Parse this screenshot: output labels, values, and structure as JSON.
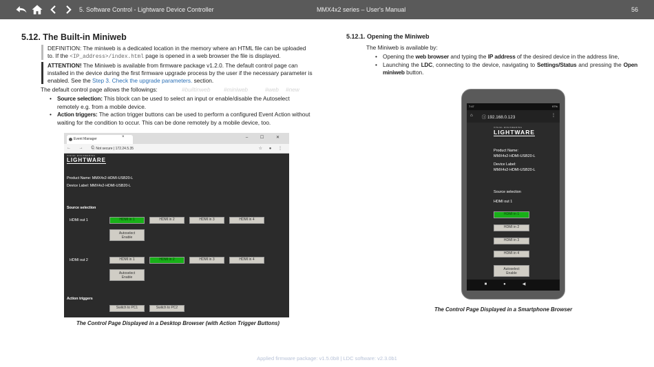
{
  "header": {
    "chapter": "5. Software Control - Lightware Device Controller",
    "manual": "MMX4x2 series – User's Manual",
    "page": "56",
    "icons": [
      "return-icon",
      "home-icon",
      "prev-icon",
      "next-icon"
    ]
  },
  "left": {
    "title": "5.12. The Built-in Miniweb",
    "definition": {
      "prefix": "DEFINITION: The miniweb is a dedicated location in the memory where an HTML file can be uploaded to. If the ",
      "code": "<IP_address>/index.html",
      "suffix": " page is opened in a web browser the file is displayed."
    },
    "attention": {
      "label": "ATTENTION!",
      "text1": " The Miniweb is available from firmware package v1.2.0. The default control page can installed in the device during the first firmware upgrade process by the user if the necessary parameter is enabled. See the ",
      "link": "Step 3. Check the upgrade parameters.",
      "text2": " section."
    },
    "default_page": "The default control page allows the followings:",
    "tags": [
      "#builtinweb",
      "#miniweb",
      "#web",
      "#new"
    ],
    "bullets": [
      {
        "label": "Source selection:",
        "text": " This block can be used to select an input or enable/disable the Autoselect remotely e.g. from a mobile device."
      },
      {
        "label": "Action triggers:",
        "text": " The action trigger buttons can be used to perform a configured Event Action without waiting for the condition to occur. This can be done remotely by a mobile device, too."
      }
    ],
    "desktop": {
      "tab": "Event Manager",
      "url_label": "Not secure",
      "url": "172.24.5.35",
      "logo": "LIGHTWARE",
      "logo_sub": "VISUAL ENGINEERING",
      "product_name": "Product Name: MMX4x2-HDMI-USB20-L",
      "device_label": "Device Label: MMX4x2-HDMI-USB20-L",
      "source_selection": "Source selection",
      "out1": "HDMI out 1",
      "out2": "HDMI out 2",
      "inputs": [
        "HDMI in 1",
        "HDMI in 2",
        "HDMI in 3",
        "HDMI in 4"
      ],
      "autoselect1": "Autoselect",
      "autoselect2": "Enable",
      "action_triggers": "Action triggers",
      "triggers": [
        "Switch to PC1",
        "Switch to PC2"
      ]
    },
    "caption": "The Control Page Displayed in a Desktop Browser (with Action Trigger Buttons)"
  },
  "right": {
    "title": "5.12.1. Opening the Miniweb",
    "intro": "The Miniweb is available by:",
    "bullets": [
      {
        "t1": "Opening the ",
        "b1": "web browser",
        "t2": " and typing the ",
        "b2": "IP address",
        "t3": " of the desired device in the address line,"
      },
      {
        "t1": "Launching the ",
        "b1": "LDC",
        "t2": ", connecting to the device, navigating to ",
        "b2": "Settings/Status",
        "t3": " and pressing the ",
        "b3": "Open miniweb",
        "t4": " button."
      }
    ],
    "phone": {
      "time": "7:47",
      "battery": "97%",
      "url": "192.168.0.123",
      "logo": "LIGHTWARE",
      "logo_sub": "VISUAL ENGINEERING",
      "product_name_label": "Product Name:",
      "product_name": "MMX4x2-HDMI-USB20-L",
      "device_label_label": "Device Label:",
      "device_label": "MMX4x2-HDMI-USB20-L",
      "source_selection": "Source selection",
      "out1": "HDMI out 1",
      "inputs": [
        "HDMI in 1",
        "HDMI in 2",
        "HDMI in 3",
        "HDMI in 4"
      ],
      "autoselect1": "Autoselect",
      "autoselect2": "Enable"
    },
    "caption": "The Control Page Displayed in a Smartphone Browser"
  },
  "footer": "Applied firmware package: v1.5.0b8    |    LDC software: v2.3.0b1"
}
